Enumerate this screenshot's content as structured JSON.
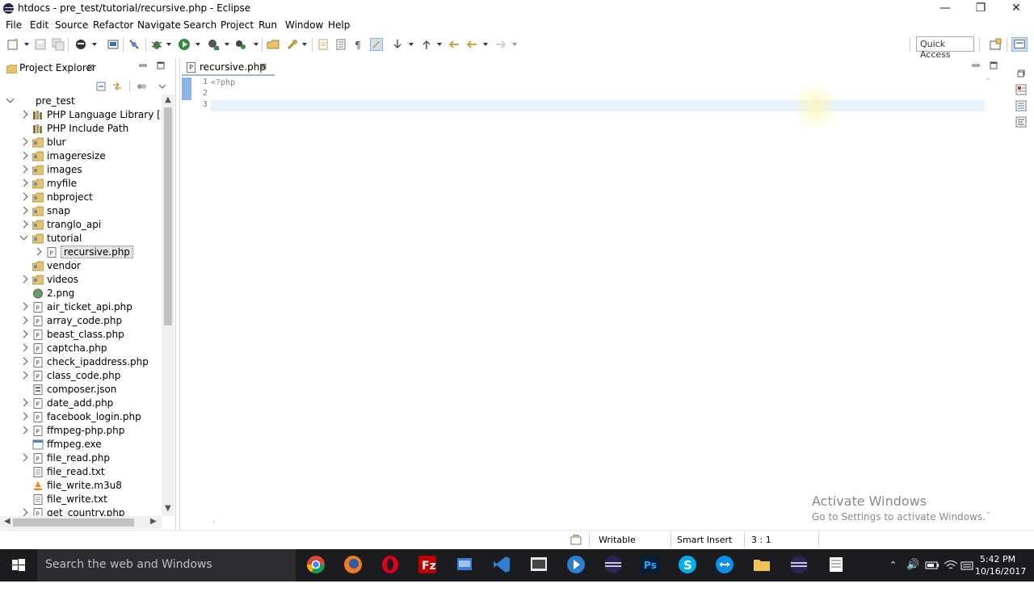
{
  "window": {
    "title": "htdocs - pre_test/tutorial/recursive.php - Eclipse",
    "minimize_glyph": "—",
    "restore_glyph": "❐",
    "close_glyph": "✕"
  },
  "menu": [
    "File",
    "Edit",
    "Source",
    "Refactor",
    "Navigate",
    "Search",
    "Project",
    "Run",
    "Window",
    "Help"
  ],
  "toolbar": {
    "quick_access": "Quick Access"
  },
  "project_explorer": {
    "tab_label": "Project Explorer",
    "tab_close": "⊠",
    "tree": [
      {
        "label": "pre_test",
        "depth": 0,
        "twisty": "open",
        "icon": "project-icon"
      },
      {
        "label": "PHP Language Library [PHP",
        "depth": 1,
        "twisty": "closed",
        "icon": "library-icon"
      },
      {
        "label": "PHP Include Path",
        "depth": 1,
        "twisty": "none",
        "icon": "library-icon"
      },
      {
        "label": "blur",
        "depth": 1,
        "twisty": "closed",
        "icon": "folder-icon"
      },
      {
        "label": "imageresize",
        "depth": 1,
        "twisty": "closed",
        "icon": "folder-icon"
      },
      {
        "label": "images",
        "depth": 1,
        "twisty": "closed",
        "icon": "folder-icon"
      },
      {
        "label": "myfile",
        "depth": 1,
        "twisty": "closed",
        "icon": "folder-icon"
      },
      {
        "label": "nbproject",
        "depth": 1,
        "twisty": "closed",
        "icon": "folder-icon"
      },
      {
        "label": "snap",
        "depth": 1,
        "twisty": "closed",
        "icon": "folder-icon"
      },
      {
        "label": "tranglo_api",
        "depth": 1,
        "twisty": "closed",
        "icon": "folder-icon"
      },
      {
        "label": "tutorial",
        "depth": 1,
        "twisty": "open",
        "icon": "folder-icon"
      },
      {
        "label": "recursive.php",
        "depth": 2,
        "twisty": "closed",
        "icon": "php-file-icon",
        "selected": true
      },
      {
        "label": "vendor",
        "depth": 1,
        "twisty": "none",
        "icon": "folder-icon"
      },
      {
        "label": "videos",
        "depth": 1,
        "twisty": "closed",
        "icon": "folder-icon"
      },
      {
        "label": "2.png",
        "depth": 1,
        "twisty": "none",
        "icon": "image-file-icon"
      },
      {
        "label": "air_ticket_api.php",
        "depth": 1,
        "twisty": "closed",
        "icon": "php-file-icon"
      },
      {
        "label": "array_code.php",
        "depth": 1,
        "twisty": "closed",
        "icon": "php-file-icon"
      },
      {
        "label": "beast_class.php",
        "depth": 1,
        "twisty": "closed",
        "icon": "php-file-icon"
      },
      {
        "label": "captcha.php",
        "depth": 1,
        "twisty": "closed",
        "icon": "php-file-icon"
      },
      {
        "label": "check_ipaddress.php",
        "depth": 1,
        "twisty": "closed",
        "icon": "php-file-icon"
      },
      {
        "label": "class_code.php",
        "depth": 1,
        "twisty": "closed",
        "icon": "php-file-icon"
      },
      {
        "label": "composer.json",
        "depth": 1,
        "twisty": "none",
        "icon": "json-file-icon"
      },
      {
        "label": "date_add.php",
        "depth": 1,
        "twisty": "closed",
        "icon": "php-file-icon"
      },
      {
        "label": "facebook_login.php",
        "depth": 1,
        "twisty": "closed",
        "icon": "php-file-icon"
      },
      {
        "label": "ffmpeg-php.php",
        "depth": 1,
        "twisty": "closed",
        "icon": "php-file-icon"
      },
      {
        "label": "ffmpeg.exe",
        "depth": 1,
        "twisty": "none",
        "icon": "exe-file-icon"
      },
      {
        "label": "file_read.php",
        "depth": 1,
        "twisty": "closed",
        "icon": "php-file-icon"
      },
      {
        "label": "file_read.txt",
        "depth": 1,
        "twisty": "none",
        "icon": "text-file-icon"
      },
      {
        "label": "file_write.m3u8",
        "depth": 1,
        "twisty": "none",
        "icon": "vlc-file-icon"
      },
      {
        "label": "file_write.txt",
        "depth": 1,
        "twisty": "none",
        "icon": "text-file-icon"
      },
      {
        "label": "get_country.php",
        "depth": 1,
        "twisty": "closed",
        "icon": "php-file-icon"
      }
    ]
  },
  "editor": {
    "tab_label": "recursive.php",
    "tab_close": "⊠",
    "line_numbers": [
      "1",
      "2",
      "3"
    ],
    "lines": [
      "<?php",
      "",
      ""
    ],
    "current_line": 3
  },
  "watermark": {
    "line1": "Activate Windows",
    "line2": "Go to Settings to activate Windows."
  },
  "status": {
    "writable": "Writable",
    "insert_mode": "Smart Insert",
    "position": "3 : 1"
  },
  "taskbar": {
    "search_placeholder": "Search the web and Windows",
    "time": "5:42 PM",
    "date": "10/16/2017"
  },
  "colors": {
    "selection_line": "#e8f2fe",
    "taskbar": "#1a1c20",
    "folder": "#e8c26a"
  }
}
